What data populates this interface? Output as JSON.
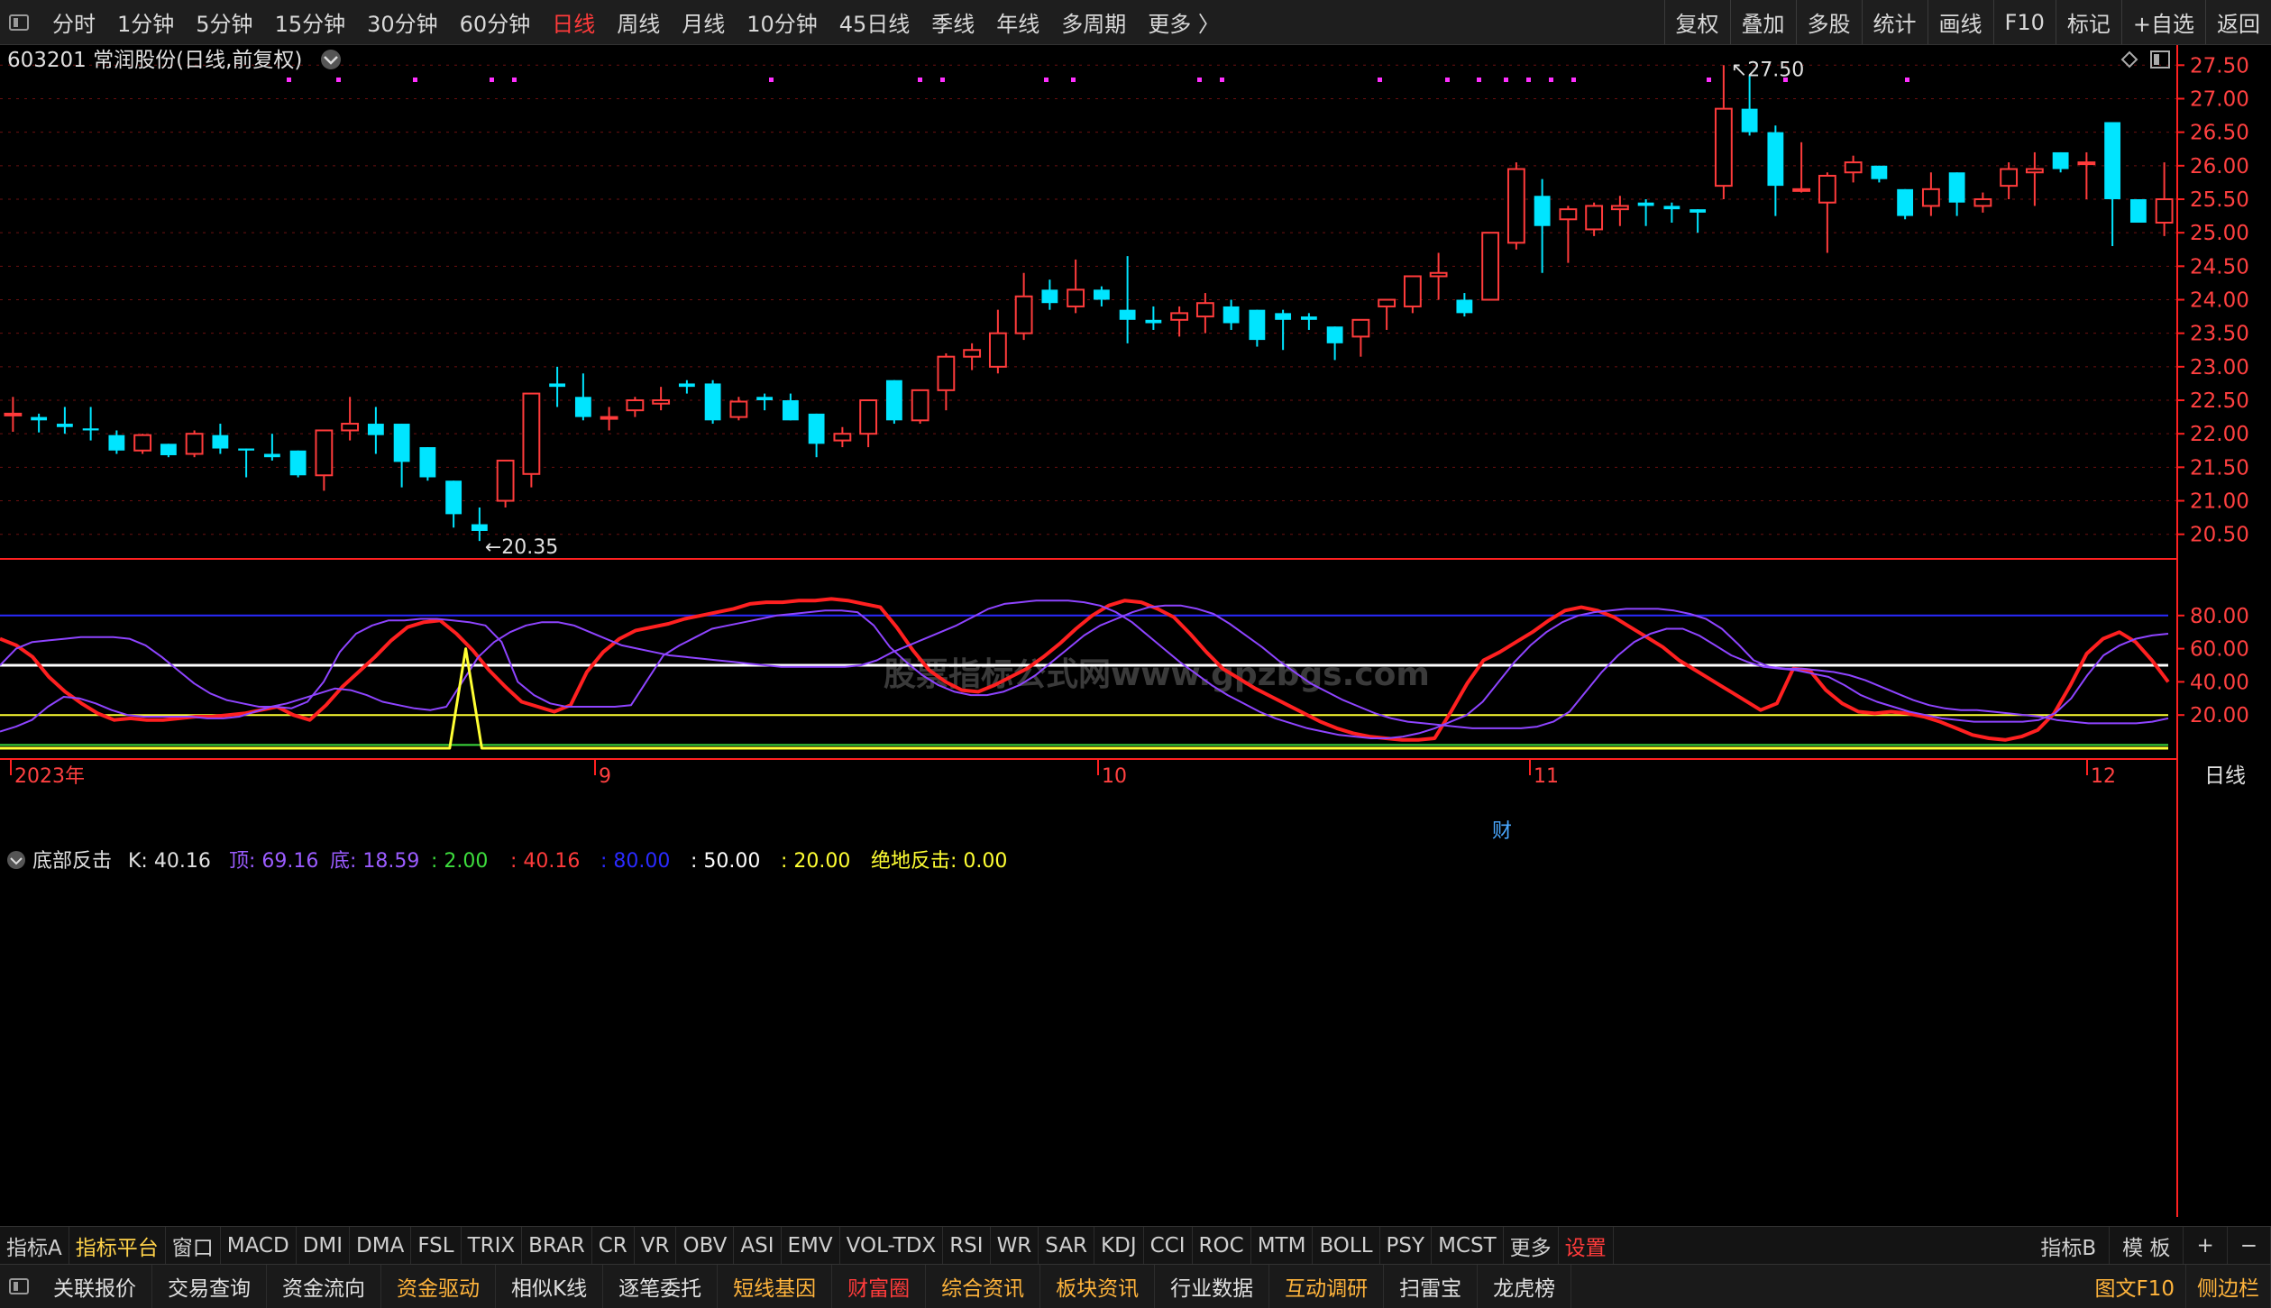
{
  "topbar": {
    "periods": [
      {
        "label": "分时"
      },
      {
        "label": "1分钟"
      },
      {
        "label": "5分钟"
      },
      {
        "label": "15分钟"
      },
      {
        "label": "30分钟"
      },
      {
        "label": "60分钟"
      },
      {
        "label": "日线",
        "active": true
      },
      {
        "label": "周线"
      },
      {
        "label": "月线"
      },
      {
        "label": "10分钟"
      },
      {
        "label": "45日线"
      },
      {
        "label": "季线"
      },
      {
        "label": "年线"
      },
      {
        "label": "多周期"
      },
      {
        "label": "更多 〉"
      }
    ],
    "right": [
      "复权",
      "叠加",
      "多股",
      "统计",
      "画线",
      "F10",
      "标记",
      "+自选",
      "返回"
    ]
  },
  "stock": {
    "title": "603201 常润股份(日线,前复权)"
  },
  "colors": {
    "up": "#ff3b3b",
    "down": "#00e5ff",
    "bg": "#000000",
    "grid": "#6b1010",
    "axis": "#ff2020"
  },
  "watermark": "股票指标公式网www.gpzbgs.com",
  "annotations": {
    "high": "27.50",
    "low": "20.35",
    "cai": "财"
  },
  "price_axis": {
    "ticks": [
      "27.50",
      "27.00",
      "26.50",
      "26.00",
      "25.50",
      "25.00",
      "24.50",
      "24.00",
      "23.50",
      "23.00",
      "22.50",
      "22.00",
      "21.50",
      "21.00",
      "20.50"
    ]
  },
  "indicator": {
    "name": "底部反击",
    "legend": [
      {
        "text": "K: 40.16",
        "color": "#e0e0e0"
      },
      {
        "text": "顶: 69.16",
        "color": "#9b5cff"
      },
      {
        "text": "底: 18.59",
        "color": "#9b5cff"
      },
      {
        "text": ": 2.00",
        "color": "#3ddc3d"
      },
      {
        "text": ": 40.16",
        "color": "#ff3b3b"
      },
      {
        "text": ": 80.00",
        "color": "#2a2aff"
      },
      {
        "text": ": 50.00",
        "color": "#ffffff"
      },
      {
        "text": ": 20.00",
        "color": "#ffff33"
      },
      {
        "text": "绝地反击: 0.00",
        "color": "#ffff33"
      }
    ],
    "axis_ticks": [
      "80.00",
      "60.00",
      "40.00",
      "20.00"
    ]
  },
  "date_axis": {
    "labels": [
      "2023年",
      "9",
      "10",
      "11",
      "12"
    ],
    "period_label": "日线"
  },
  "chart_data": {
    "type": "candlestick",
    "title": "603201 常润股份(日线,前复权)",
    "ylim": [
      20.2,
      27.8
    ],
    "candles": [
      [
        22.3,
        22.55,
        22.03,
        22.3
      ],
      [
        22.25,
        22.3,
        22.02,
        22.2
      ],
      [
        22.15,
        22.4,
        22.0,
        22.1
      ],
      [
        22.08,
        22.4,
        21.9,
        22.05
      ],
      [
        21.98,
        22.05,
        21.7,
        21.75
      ],
      [
        21.75,
        22.0,
        21.7,
        21.98
      ],
      [
        21.85,
        21.85,
        21.65,
        21.68
      ],
      [
        21.7,
        22.05,
        21.65,
        22.0
      ],
      [
        21.98,
        22.15,
        21.7,
        21.78
      ],
      [
        21.78,
        21.78,
        21.35,
        21.75
      ],
      [
        21.7,
        22.0,
        21.6,
        21.65
      ],
      [
        21.75,
        21.75,
        21.35,
        21.38
      ],
      [
        21.38,
        22.05,
        21.15,
        22.05
      ],
      [
        22.05,
        22.55,
        21.9,
        22.15
      ],
      [
        22.15,
        22.4,
        21.7,
        21.98
      ],
      [
        22.15,
        22.15,
        21.2,
        21.58
      ],
      [
        21.8,
        21.8,
        21.3,
        21.35
      ],
      [
        21.3,
        21.3,
        20.6,
        20.8
      ],
      [
        20.65,
        20.9,
        20.4,
        20.55
      ],
      [
        21.0,
        21.0,
        20.9,
        21.6
      ],
      [
        21.4,
        22.6,
        21.2,
        22.6
      ],
      [
        22.75,
        23.0,
        22.4,
        22.7
      ],
      [
        22.55,
        22.9,
        22.2,
        22.25
      ],
      [
        22.25,
        22.4,
        22.05,
        22.25
      ],
      [
        22.35,
        22.55,
        22.25,
        22.5
      ],
      [
        22.45,
        22.7,
        22.35,
        22.5
      ],
      [
        22.75,
        22.8,
        22.6,
        22.7
      ],
      [
        22.75,
        22.8,
        22.15,
        22.2
      ],
      [
        22.25,
        22.55,
        22.2,
        22.48
      ],
      [
        22.55,
        22.6,
        22.35,
        22.5
      ],
      [
        22.5,
        22.6,
        22.2,
        22.2
      ],
      [
        22.3,
        22.3,
        21.65,
        21.85
      ],
      [
        21.9,
        22.1,
        21.8,
        22.0
      ],
      [
        22.0,
        22.35,
        21.8,
        22.5
      ],
      [
        22.8,
        22.8,
        22.15,
        22.2
      ],
      [
        22.2,
        22.6,
        22.15,
        22.65
      ],
      [
        22.65,
        23.2,
        22.35,
        23.15
      ],
      [
        23.15,
        23.35,
        22.95,
        23.25
      ],
      [
        23.0,
        23.85,
        22.9,
        23.5
      ],
      [
        23.5,
        24.4,
        23.4,
        24.05
      ],
      [
        24.15,
        24.3,
        23.85,
        23.95
      ],
      [
        23.9,
        24.6,
        23.8,
        24.15
      ],
      [
        24.15,
        24.2,
        23.9,
        24.0
      ],
      [
        23.85,
        24.65,
        23.35,
        23.7
      ],
      [
        23.7,
        23.9,
        23.55,
        23.65
      ],
      [
        23.7,
        23.9,
        23.45,
        23.8
      ],
      [
        23.75,
        24.1,
        23.5,
        23.95
      ],
      [
        23.9,
        24.0,
        23.55,
        23.65
      ],
      [
        23.85,
        23.85,
        23.3,
        23.4
      ],
      [
        23.8,
        23.85,
        23.25,
        23.7
      ],
      [
        23.75,
        23.8,
        23.55,
        23.7
      ],
      [
        23.6,
        23.6,
        23.1,
        23.35
      ],
      [
        23.45,
        23.7,
        23.15,
        23.7
      ],
      [
        23.9,
        24.0,
        23.55,
        24.0
      ],
      [
        23.9,
        24.35,
        23.8,
        24.35
      ],
      [
        24.35,
        24.7,
        24.0,
        24.4
      ],
      [
        24.0,
        24.1,
        23.75,
        23.8
      ],
      [
        24.0,
        25.0,
        24.0,
        25.0
      ],
      [
        24.85,
        26.05,
        24.75,
        25.95
      ],
      [
        25.55,
        25.8,
        24.4,
        25.1
      ],
      [
        25.2,
        25.4,
        24.55,
        25.35
      ],
      [
        25.05,
        25.45,
        24.95,
        25.4
      ],
      [
        25.35,
        25.55,
        25.1,
        25.4
      ],
      [
        25.45,
        25.5,
        25.1,
        25.4
      ],
      [
        25.4,
        25.45,
        25.15,
        25.35
      ],
      [
        25.35,
        25.35,
        25.0,
        25.3
      ],
      [
        25.7,
        27.5,
        25.5,
        26.85
      ],
      [
        26.85,
        27.35,
        26.45,
        26.5
      ],
      [
        26.5,
        26.6,
        25.25,
        25.7
      ],
      [
        25.65,
        26.35,
        25.6,
        25.65
      ],
      [
        25.45,
        25.9,
        24.7,
        25.85
      ],
      [
        25.9,
        26.15,
        25.75,
        26.05
      ],
      [
        26.0,
        26.0,
        25.75,
        25.8
      ],
      [
        25.65,
        25.65,
        25.2,
        25.25
      ],
      [
        25.4,
        25.9,
        25.25,
        25.65
      ],
      [
        25.9,
        25.9,
        25.25,
        25.45
      ],
      [
        25.4,
        25.6,
        25.3,
        25.5
      ],
      [
        25.7,
        26.05,
        25.5,
        25.95
      ],
      [
        25.9,
        26.2,
        25.4,
        25.95
      ],
      [
        26.2,
        26.2,
        25.9,
        25.95
      ],
      [
        26.05,
        26.2,
        25.5,
        26.05
      ],
      [
        26.65,
        26.65,
        24.8,
        25.5
      ],
      [
        25.5,
        25.5,
        25.15,
        25.15
      ],
      [
        25.15,
        26.05,
        24.95,
        25.5
      ]
    ],
    "series": [
      {
        "name": "K",
        "color": "#ff2020",
        "values": [
          66,
          62,
          55,
          43,
          34,
          27,
          21,
          17,
          18,
          17,
          17,
          18,
          19,
          19,
          20,
          21,
          23,
          25,
          20,
          17,
          26,
          37,
          46,
          55,
          65,
          73,
          76,
          77,
          69,
          59,
          47,
          37,
          28,
          25,
          22,
          26,
          46,
          58,
          66,
          71,
          73,
          75,
          78,
          80,
          82,
          84,
          87,
          88,
          88,
          89,
          89,
          90,
          89,
          87,
          85,
          73,
          59,
          47,
          40,
          35,
          34,
          38,
          43,
          48,
          55,
          63,
          72,
          80,
          86,
          89,
          88,
          84,
          79,
          69,
          58,
          48,
          42,
          36,
          31,
          26,
          21,
          16,
          12,
          9,
          7,
          6,
          5,
          5,
          6,
          22,
          39,
          53,
          58,
          64,
          70,
          77,
          83,
          85,
          83,
          79,
          73,
          67,
          61,
          53,
          47,
          41,
          35,
          29,
          23,
          27,
          48,
          47,
          35,
          27,
          22,
          21,
          22,
          21,
          19,
          16,
          12,
          8,
          6,
          5,
          7,
          11,
          21,
          38,
          57,
          66,
          70,
          64,
          53,
          40
        ]
      },
      {
        "name": "顶",
        "color": "#8e44ff",
        "values": [
          50,
          60,
          64,
          65,
          66,
          67,
          67,
          67,
          66,
          62,
          55,
          47,
          39,
          33,
          29,
          27,
          25,
          25,
          24,
          28,
          40,
          58,
          69,
          74,
          77,
          77,
          78,
          78,
          77,
          76,
          74,
          64,
          40,
          32,
          27,
          25,
          25,
          25,
          25,
          26,
          41,
          56,
          62,
          67,
          72,
          74,
          76,
          78,
          80,
          81,
          82,
          83,
          83,
          82,
          74,
          61,
          52,
          44,
          38,
          34,
          32,
          32,
          34,
          38,
          44,
          52,
          60,
          68,
          74,
          78,
          82,
          85,
          86,
          86,
          84,
          81,
          75,
          68,
          61,
          53,
          46,
          39,
          34,
          29,
          25,
          21,
          18,
          16,
          15,
          14,
          13,
          12,
          12,
          12,
          12,
          13,
          16,
          22,
          34,
          46,
          56,
          64,
          69,
          72,
          72,
          68,
          62,
          56,
          52,
          49,
          48,
          47,
          45,
          43,
          38,
          32,
          28,
          25,
          22,
          20,
          18,
          17,
          16,
          16,
          16,
          16,
          17,
          21,
          30,
          44,
          56,
          62,
          66,
          68,
          69
        ]
      },
      {
        "name": "底",
        "color": "#8e44ff",
        "values": [
          10,
          13,
          17,
          25,
          31,
          30,
          27,
          23,
          20,
          19,
          19,
          19,
          19,
          18,
          18,
          19,
          22,
          25,
          27,
          30,
          33,
          36,
          35,
          32,
          28,
          26,
          24,
          23,
          25,
          40,
          55,
          64,
          70,
          74,
          76,
          76,
          74,
          70,
          66,
          62,
          60,
          58,
          56,
          55,
          54,
          53,
          52,
          51,
          50,
          49,
          49,
          49,
          49,
          49,
          50,
          53,
          58,
          62,
          66,
          70,
          74,
          79,
          84,
          87,
          88,
          89,
          89,
          89,
          88,
          86,
          82,
          76,
          68,
          60,
          52,
          45,
          38,
          32,
          27,
          22,
          18,
          15,
          12,
          10,
          8,
          7,
          6,
          6,
          7,
          9,
          12,
          16,
          20,
          28,
          40,
          52,
          62,
          70,
          76,
          80,
          82,
          83,
          84,
          84,
          84,
          83,
          81,
          78,
          72,
          63,
          53,
          49,
          48,
          48,
          47,
          46,
          44,
          41,
          37,
          33,
          29,
          26,
          24,
          23,
          23,
          22,
          21,
          20,
          19,
          17,
          16,
          15,
          15,
          15,
          15,
          16,
          18
        ]
      },
      {
        "name": "绝地反击",
        "color": "#ffff33",
        "values": [
          0,
          0,
          0,
          0,
          0,
          0,
          0,
          0,
          0,
          0,
          0,
          0,
          0,
          0,
          0,
          0,
          0,
          0,
          0,
          0,
          0,
          0,
          0,
          0,
          0,
          0,
          0,
          0,
          0,
          60,
          0,
          0,
          0,
          0,
          0,
          0,
          0,
          0,
          0,
          0,
          0,
          0,
          0,
          0,
          0,
          0,
          0,
          0,
          0,
          0,
          0,
          0,
          0,
          0,
          0,
          0,
          0,
          0,
          0,
          0,
          0,
          0,
          0,
          0,
          0,
          0,
          0,
          0,
          0,
          0,
          0,
          0,
          0,
          0,
          0,
          0,
          0,
          0,
          0,
          0,
          0,
          0,
          0,
          0,
          0,
          0,
          0,
          0,
          0,
          0,
          0,
          0,
          0,
          0,
          0,
          0,
          0,
          0,
          0,
          0,
          0,
          0,
          0,
          0,
          0,
          0,
          0,
          0,
          0,
          0,
          0,
          0,
          0,
          0,
          0,
          0,
          0,
          0,
          0,
          0,
          0,
          0,
          0,
          0,
          0,
          0,
          0,
          0,
          0,
          0,
          0,
          0,
          0,
          0,
          0,
          0
        ]
      }
    ],
    "ind_ylim": [
      0,
      100
    ],
    "hlines": [
      {
        "value": 80,
        "color": "#2a2aff"
      },
      {
        "value": 50,
        "color": "#ffffff"
      },
      {
        "value": 20,
        "color": "#ffff33"
      },
      {
        "value": 2,
        "color": "#3ddc3d"
      }
    ]
  },
  "indicator_tabs": {
    "items": [
      {
        "label": "指标A"
      },
      {
        "label": "指标平台",
        "hl": true
      },
      {
        "label": "窗口"
      },
      {
        "label": "MACD"
      },
      {
        "label": "DMI"
      },
      {
        "label": "DMA"
      },
      {
        "label": "FSL"
      },
      {
        "label": "TRIX"
      },
      {
        "label": "BRAR"
      },
      {
        "label": "CR"
      },
      {
        "label": "VR"
      },
      {
        "label": "OBV"
      },
      {
        "label": "ASI"
      },
      {
        "label": "EMV"
      },
      {
        "label": "VOL-TDX"
      },
      {
        "label": "RSI"
      },
      {
        "label": "WR"
      },
      {
        "label": "SAR"
      },
      {
        "label": "KDJ"
      },
      {
        "label": "CCI"
      },
      {
        "label": "ROC"
      },
      {
        "label": "MTM"
      },
      {
        "label": "BOLL"
      },
      {
        "label": "PSY"
      },
      {
        "label": "MCST"
      },
      {
        "label": "更多"
      },
      {
        "label": "设置",
        "red": true
      }
    ],
    "right": [
      "指标B",
      "模 板",
      "+",
      "−"
    ]
  },
  "bottombar": {
    "items": [
      {
        "label": "关联报价",
        "color": "#e0e0e0"
      },
      {
        "label": "交易查询",
        "color": "#e0e0e0"
      },
      {
        "label": "资金流向",
        "color": "#e0e0e0"
      },
      {
        "label": "资金驱动",
        "color": "#ffb43c"
      },
      {
        "label": "相似K线",
        "color": "#e0e0e0"
      },
      {
        "label": "逐笔委托",
        "color": "#e0e0e0"
      },
      {
        "label": "短线基因",
        "color": "#ffb43c"
      },
      {
        "label": "财富圈",
        "color": "#ff3b3b"
      },
      {
        "label": "综合资讯",
        "color": "#ffb43c"
      },
      {
        "label": "板块资讯",
        "color": "#ffb43c"
      },
      {
        "label": "行业数据",
        "color": "#e0e0e0"
      },
      {
        "label": "互动调研",
        "color": "#ffb43c"
      },
      {
        "label": "扫雷宝",
        "color": "#e0e0e0"
      },
      {
        "label": "龙虎榜",
        "color": "#e0e0e0"
      }
    ],
    "right": [
      {
        "label": "图文F10",
        "color": "#ffb43c"
      },
      {
        "label": "侧边栏",
        "color": "#ffb43c"
      }
    ]
  }
}
